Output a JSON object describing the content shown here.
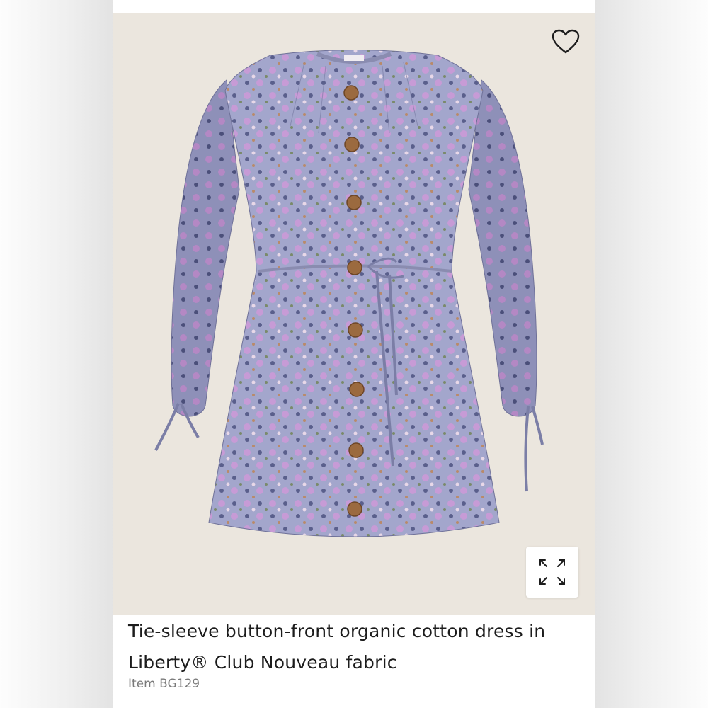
{
  "product": {
    "title": "Tie-sleeve button-front organic cotton dress in Liberty® Club Nouveau fabric",
    "item_number": "Item BG129"
  },
  "icons": {
    "wishlist": "heart-icon",
    "expand": "expand-icon"
  },
  "colors": {
    "image_background": "#ebe6de",
    "dress_base": "#9c9cc6",
    "dress_accent": "#c69ad4",
    "button": "#9b6a3f",
    "text": "#1c1c1c",
    "muted_text": "#7a7a7a"
  }
}
